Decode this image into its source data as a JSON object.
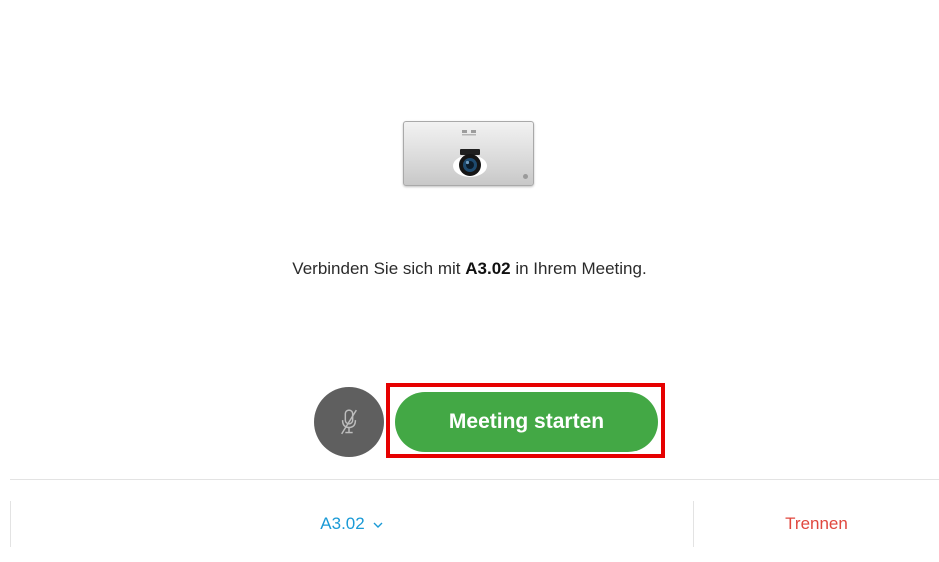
{
  "device": {
    "icon": "video-device-icon"
  },
  "message": {
    "before": "Verbinden Sie sich mit",
    "room": "A3.02",
    "after": "in Ihrem Meeting."
  },
  "controls": {
    "mute_icon": "microphone-muted-icon",
    "start_label": "Meeting starten",
    "start_color": "#43a845",
    "highlight_color": "#e60000"
  },
  "footer": {
    "device_label": "A3.02",
    "device_color": "#1a9ad6",
    "chevron_icon": "chevron-down-icon",
    "disconnect_label": "Trennen",
    "disconnect_color": "#e0473e"
  }
}
